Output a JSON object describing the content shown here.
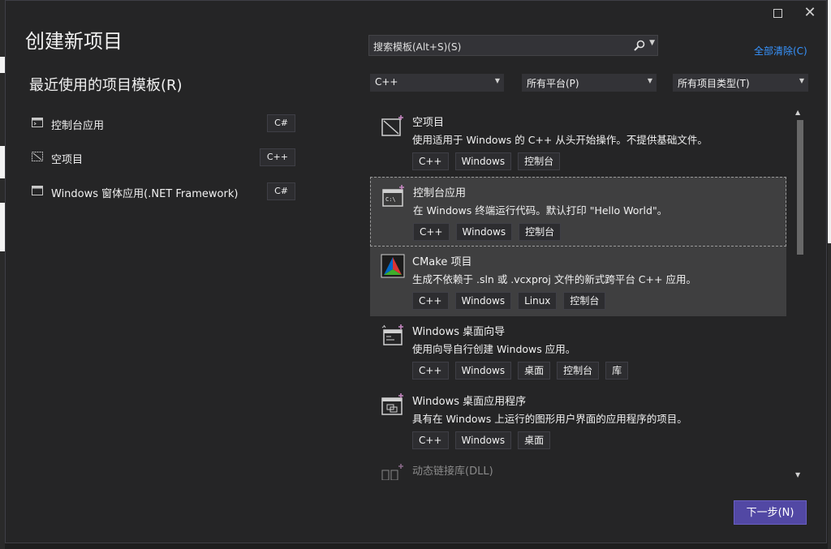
{
  "dialog": {
    "title": "创建新项目",
    "maximize_label": "",
    "close_label": "✕"
  },
  "recent": {
    "heading": "最近使用的项目模板(R)",
    "items": [
      {
        "label": "控制台应用",
        "lang": "C#",
        "icon": "console-app-icon"
      },
      {
        "label": "空项目",
        "lang": "C++",
        "icon": "empty-project-icon"
      },
      {
        "label": "Windows 窗体应用(.NET Framework)",
        "lang": "C#",
        "icon": "windows-forms-icon"
      }
    ]
  },
  "search": {
    "placeholder": "搜索模板(Alt+S)(S)",
    "clear_all": "全部清除(C)"
  },
  "filters": {
    "language": "C++",
    "platform": "所有平台(P)",
    "project_type": "所有项目类型(T)"
  },
  "templates": [
    {
      "name": "空项目",
      "desc": "使用适用于 Windows 的 C++ 从头开始操作。不提供基础文件。",
      "tags": [
        "C++",
        "Windows",
        "控制台"
      ],
      "icon": "empty-project-icon"
    },
    {
      "name": "控制台应用",
      "desc": "在 Windows 终端运行代码。默认打印 \"Hello World\"。",
      "tags": [
        "C++",
        "Windows",
        "控制台"
      ],
      "icon": "console-app-icon"
    },
    {
      "name": "CMake 项目",
      "desc": "生成不依赖于 .sln 或 .vcxproj 文件的新式跨平台 C++ 应用。",
      "tags": [
        "C++",
        "Windows",
        "Linux",
        "控制台"
      ],
      "icon": "cmake-icon"
    },
    {
      "name": "Windows 桌面向导",
      "desc": "使用向导自行创建 Windows 应用。",
      "tags": [
        "C++",
        "Windows",
        "桌面",
        "控制台",
        "库"
      ],
      "icon": "desktop-wizard-icon"
    },
    {
      "name": "Windows 桌面应用程序",
      "desc": "具有在 Windows 上运行的图形用户界面的应用程序的项目。",
      "tags": [
        "C++",
        "Windows",
        "桌面"
      ],
      "icon": "desktop-app-icon"
    },
    {
      "name": "动态链接库(DLL)",
      "desc": "",
      "tags": [],
      "icon": "dll-icon"
    }
  ],
  "footer": {
    "next_label": "下一步(N)"
  },
  "colors": {
    "accent": "#5248a4",
    "link": "#3794ff",
    "background": "#252526"
  }
}
